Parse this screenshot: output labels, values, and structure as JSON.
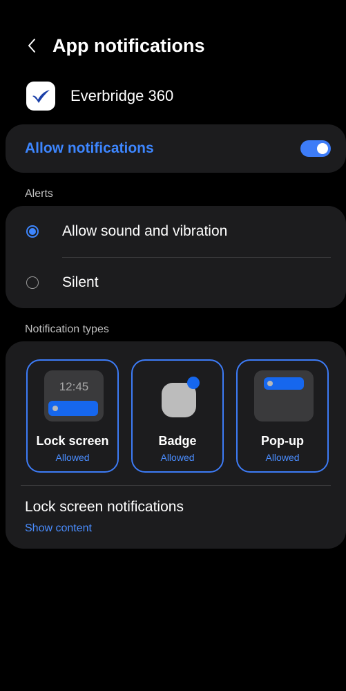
{
  "header": {
    "title": "App notifications",
    "back_icon": "chevron-left-icon"
  },
  "app": {
    "name": "Everbridge 360",
    "icon": "everbridge-checkmark-icon",
    "icon_color": "#1a3fa8"
  },
  "allow_notifications": {
    "label": "Allow notifications",
    "enabled": true,
    "accent": "#3d86ff"
  },
  "alerts": {
    "section_label": "Alerts",
    "options": [
      {
        "label": "Allow sound and vibration",
        "selected": true
      },
      {
        "label": "Silent",
        "selected": false
      }
    ]
  },
  "notification_types": {
    "section_label": "Notification types",
    "items": [
      {
        "name": "Lock screen",
        "status": "Allowed",
        "preview_time": "12:45",
        "selected": true
      },
      {
        "name": "Badge",
        "status": "Allowed",
        "selected": true
      },
      {
        "name": "Pop-up",
        "status": "Allowed",
        "selected": true
      }
    ]
  },
  "lock_screen_notifications": {
    "title": "Lock screen notifications",
    "value": "Show content"
  },
  "colors": {
    "background": "#000000",
    "card": "#1c1c1e",
    "accent": "#3d86ff"
  }
}
